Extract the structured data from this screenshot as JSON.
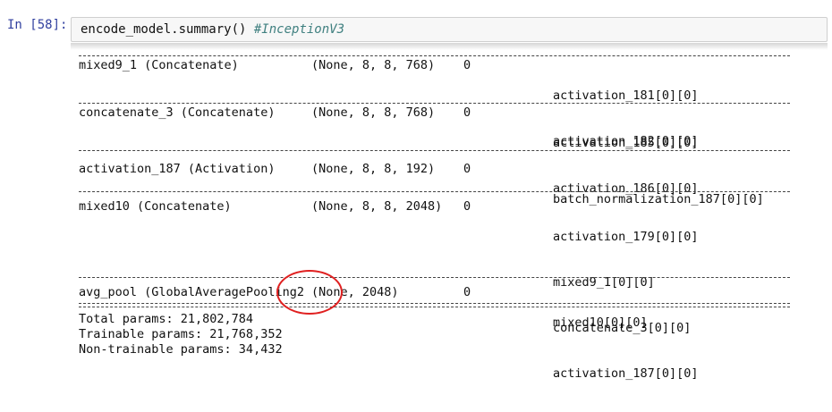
{
  "cell": {
    "prompt": "In [58]:",
    "code": "encode_model.summary()",
    "comment": "#InceptionV3"
  },
  "summary": {
    "rows": [
      {
        "name": "mixed9_1 (Concatenate)",
        "shape": "(None, 8, 8, 768)",
        "params": "0",
        "connected": [
          "activation_181[0][0]",
          "activation_182[0][0]"
        ]
      },
      {
        "name": "concatenate_3 (Concatenate)",
        "shape": "(None, 8, 8, 768)",
        "params": "0",
        "connected": [
          "activation_185[0][0]",
          "activation_186[0][0]"
        ]
      },
      {
        "name": "activation_187 (Activation)",
        "shape": "(None, 8, 8, 192)",
        "params": "0",
        "connected": [
          "batch_normalization_187[0][0]"
        ]
      },
      {
        "name": "mixed10 (Concatenate)",
        "shape": "(None, 8, 8, 2048)",
        "params": "0",
        "connected": [
          "activation_179[0][0]",
          "mixed9_1[0][0]",
          "concatenate_3[0][0]",
          "activation_187[0][0]"
        ]
      },
      {
        "name": "avg_pool (GlobalAveragePooling2",
        "shape": "(None, 2048)",
        "params": "0",
        "connected": [
          "mixed10[0][0]"
        ]
      }
    ],
    "total_params": "Total params: 21,802,784",
    "trainable_params": "Trainable params: 21,768,352",
    "non_trainable_params": "Non-trainable params: 34,432"
  },
  "colors": {
    "prompt": "#303f9f",
    "annotation": "#e02020"
  }
}
